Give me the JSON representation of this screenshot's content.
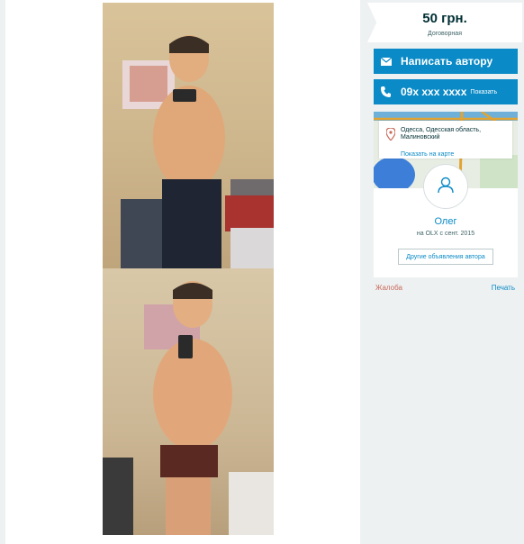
{
  "price": {
    "amount": "50 грн.",
    "note": "Договорная"
  },
  "contact": {
    "write_label": "Написать автору",
    "phone_masked": "09x xxx xxxx",
    "show_label": "Показать"
  },
  "location": {
    "address": "Одесса, Одесская область, Малиновский",
    "map_link": "Показать на карте"
  },
  "seller": {
    "name": "Олег",
    "since": "на OLX с сент. 2015",
    "other_ads": "Другие объявления автора"
  },
  "footer": {
    "complaint": "Жалоба",
    "print": "Печать"
  },
  "icons": {
    "write": "envelope-icon",
    "phone": "phone-icon",
    "location": "map-pin-icon",
    "avatar": "user-icon"
  },
  "colors": {
    "accent": "#0a8ac6",
    "text": "#002f34",
    "complaint": "#c9695b"
  }
}
